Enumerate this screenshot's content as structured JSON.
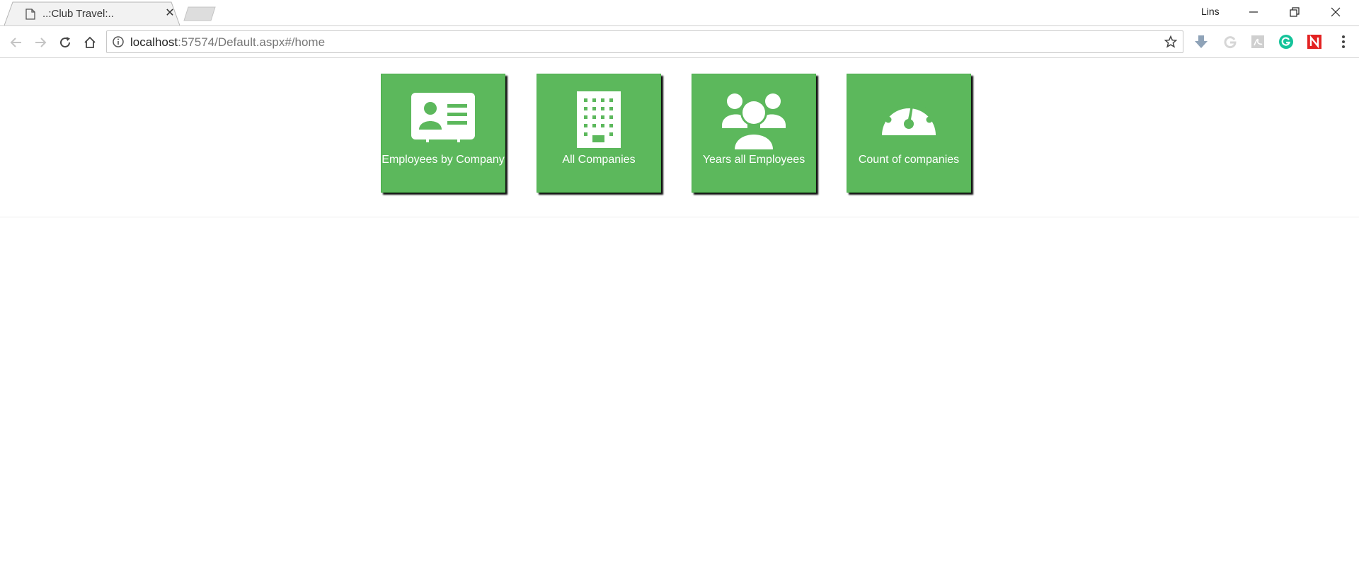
{
  "browser": {
    "tab_title": "..:Club Travel:..",
    "profile_name": "Lins",
    "url_host": "localhost",
    "url_rest": ":57574/Default.aspx#/home"
  },
  "tiles": [
    {
      "label": "Employees by Company",
      "icon": "id-card-icon"
    },
    {
      "label": "All Companies",
      "icon": "building-icon"
    },
    {
      "label": "Years all Employees",
      "icon": "users-icon"
    },
    {
      "label": "Count of companies",
      "icon": "dashboard-icon"
    }
  ],
  "colors": {
    "tile_bg": "#5cb85c",
    "tile_text": "#ffffff",
    "grammarly": "#15c39a",
    "extension_red": "#e32222"
  }
}
